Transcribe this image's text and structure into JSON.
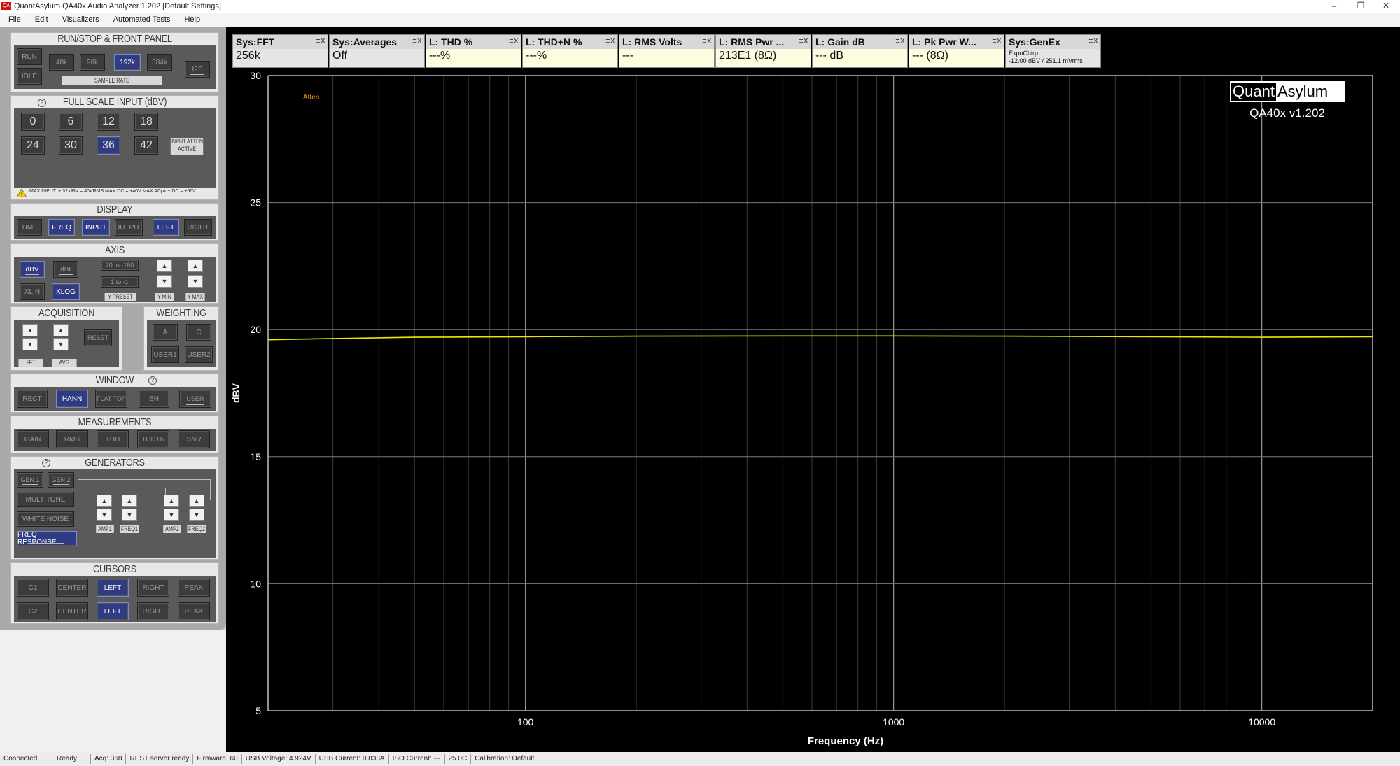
{
  "window": {
    "title": "QuantAsylum QA40x Audio Analyzer 1.202 [Default.Settings]",
    "icon_text": "QA"
  },
  "menu": [
    "File",
    "Edit",
    "Visualizers",
    "Automated Tests",
    "Help"
  ],
  "run_stop": {
    "title": "RUN/STOP & FRONT PANEL",
    "run": "RUN",
    "idle": "IDLE",
    "rates": [
      "48k",
      "96k",
      "192k",
      "384k"
    ],
    "i2s": "I2S",
    "sample_rate_label": "SAMPLE RATE"
  },
  "full_scale": {
    "title": "FULL SCALE INPUT (dBV)",
    "values": [
      "0",
      "6",
      "12",
      "18",
      "24",
      "30",
      "36",
      "42"
    ],
    "atten_note": "INPUT ATTEN ACTIVE",
    "warning": "MAX INPUT: + 32 dBV = 40VRMS    MAX DC = ±40V    MAX ACpk + DC = ±56V"
  },
  "display": {
    "title": "DISPLAY",
    "buttons": [
      "TIME",
      "FREQ",
      "INPUT",
      "OUTPUT",
      "LEFT",
      "RIGHT"
    ]
  },
  "axis": {
    "title": "AXIS",
    "dbv": "dBV",
    "dbr": "dBr",
    "xlin": "XLIN",
    "xlog": "XLOG",
    "preset1": "20 to -160",
    "preset2": "1 to -1",
    "y_preset": "Y PRESET",
    "y_min": "Y MIN",
    "y_max": "Y MAX"
  },
  "acquisition": {
    "title": "ACQUISITION",
    "reset": "RESET",
    "fft": "FFT",
    "avg": "AVG"
  },
  "weighting": {
    "title": "WEIGHTING",
    "buttons": [
      "A",
      "C",
      "USER1",
      "USER2"
    ]
  },
  "window_sec": {
    "title": "WINDOW",
    "buttons": [
      "RECT",
      "HANN",
      "FLAT TOP",
      "BH",
      "USER"
    ]
  },
  "measurements": {
    "title": "MEASUREMENTS",
    "buttons": [
      "GAIN",
      "RMS",
      "THD",
      "THD+N",
      "SNR"
    ]
  },
  "generators": {
    "title": "GENERATORS",
    "gen1": "GEN 1",
    "gen2": "GEN 2",
    "multitone": "MULTITONE",
    "white_noise": "WHITE NOISE",
    "freq_response": "FREQ RESPONSE",
    "labels": [
      "AMP1",
      "FREQ1",
      "AMP2",
      "FREQ2"
    ]
  },
  "cursors": {
    "title": "CURSORS",
    "row1": [
      "C1",
      "CENTER",
      "LEFT",
      "RIGHT",
      "PEAK"
    ],
    "row2": [
      "C2",
      "CENTER",
      "LEFT",
      "RIGHT",
      "PEAK"
    ]
  },
  "measure_boxes": [
    {
      "header": "Sys:FFT",
      "value": "256k"
    },
    {
      "header": "Sys:Averages",
      "value": "Off"
    },
    {
      "header": "L: THD %",
      "value": "---%"
    },
    {
      "header": "L: THD+N %",
      "value": "---%"
    },
    {
      "header": "L: RMS Volts",
      "value": "---"
    },
    {
      "header": "L: RMS Pwr ...",
      "value": "213E1 (8Ω)"
    },
    {
      "header": "L: Gain dB",
      "value": "--- dB"
    },
    {
      "header": "L: Pk Pwr W...",
      "value": "--- (8Ω)"
    },
    {
      "header": "Sys:GenEx",
      "value": "ExpoChirp",
      "value2": "-12.00 dBV / 251.1 mVrms"
    }
  ],
  "box_controls": "≡X",
  "logo": {
    "quant": "Quant",
    "asylum": "Asylum",
    "version": "QA40x v1.202"
  },
  "atten_flag": "Atten",
  "chart_data": {
    "type": "line",
    "xlabel": "Frequency (Hz)",
    "ylabel": "dBV",
    "xscale": "log",
    "xlim": [
      20,
      20000
    ],
    "ylim": [
      5,
      30
    ],
    "xticks": [
      "100",
      "1000",
      "10000"
    ],
    "yticks": [
      "5",
      "10",
      "15",
      "20",
      "25",
      "30"
    ],
    "grid": true,
    "series": [
      {
        "color": "#e8e800",
        "x": [
          20,
          30,
          50,
          100,
          200,
          500,
          1000,
          2000,
          5000,
          10000,
          20000
        ],
        "y": [
          19.6,
          19.65,
          19.7,
          19.72,
          19.74,
          19.75,
          19.75,
          19.74,
          19.72,
          19.7,
          19.72
        ]
      }
    ]
  },
  "status": [
    "Connected",
    "Ready",
    "Acq: 368",
    "REST server ready",
    "Firmware: 60",
    "USB Voltage: 4.924V",
    "USB Current: 0.833A",
    "ISO Current: ---",
    "25.0C",
    "Calibration: Default"
  ]
}
